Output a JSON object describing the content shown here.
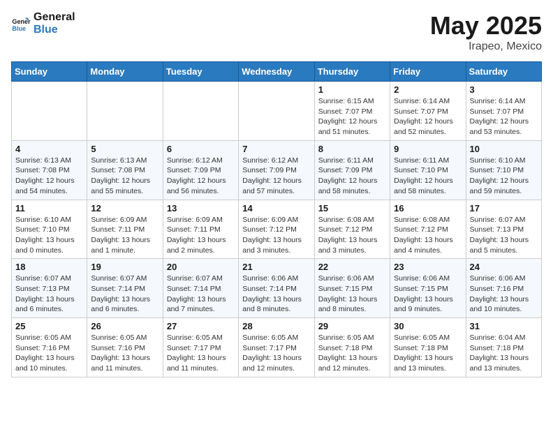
{
  "header": {
    "logo_line1": "General",
    "logo_line2": "Blue",
    "month": "May 2025",
    "location": "Irapeo, Mexico"
  },
  "weekdays": [
    "Sunday",
    "Monday",
    "Tuesday",
    "Wednesday",
    "Thursday",
    "Friday",
    "Saturday"
  ],
  "weeks": [
    [
      {
        "day": "",
        "info": ""
      },
      {
        "day": "",
        "info": ""
      },
      {
        "day": "",
        "info": ""
      },
      {
        "day": "",
        "info": ""
      },
      {
        "day": "1",
        "info": "Sunrise: 6:15 AM\nSunset: 7:07 PM\nDaylight: 12 hours\nand 51 minutes."
      },
      {
        "day": "2",
        "info": "Sunrise: 6:14 AM\nSunset: 7:07 PM\nDaylight: 12 hours\nand 52 minutes."
      },
      {
        "day": "3",
        "info": "Sunrise: 6:14 AM\nSunset: 7:07 PM\nDaylight: 12 hours\nand 53 minutes."
      }
    ],
    [
      {
        "day": "4",
        "info": "Sunrise: 6:13 AM\nSunset: 7:08 PM\nDaylight: 12 hours\nand 54 minutes."
      },
      {
        "day": "5",
        "info": "Sunrise: 6:13 AM\nSunset: 7:08 PM\nDaylight: 12 hours\nand 55 minutes."
      },
      {
        "day": "6",
        "info": "Sunrise: 6:12 AM\nSunset: 7:09 PM\nDaylight: 12 hours\nand 56 minutes."
      },
      {
        "day": "7",
        "info": "Sunrise: 6:12 AM\nSunset: 7:09 PM\nDaylight: 12 hours\nand 57 minutes."
      },
      {
        "day": "8",
        "info": "Sunrise: 6:11 AM\nSunset: 7:09 PM\nDaylight: 12 hours\nand 58 minutes."
      },
      {
        "day": "9",
        "info": "Sunrise: 6:11 AM\nSunset: 7:10 PM\nDaylight: 12 hours\nand 58 minutes."
      },
      {
        "day": "10",
        "info": "Sunrise: 6:10 AM\nSunset: 7:10 PM\nDaylight: 12 hours\nand 59 minutes."
      }
    ],
    [
      {
        "day": "11",
        "info": "Sunrise: 6:10 AM\nSunset: 7:10 PM\nDaylight: 13 hours\nand 0 minutes."
      },
      {
        "day": "12",
        "info": "Sunrise: 6:09 AM\nSunset: 7:11 PM\nDaylight: 13 hours\nand 1 minute."
      },
      {
        "day": "13",
        "info": "Sunrise: 6:09 AM\nSunset: 7:11 PM\nDaylight: 13 hours\nand 2 minutes."
      },
      {
        "day": "14",
        "info": "Sunrise: 6:09 AM\nSunset: 7:12 PM\nDaylight: 13 hours\nand 3 minutes."
      },
      {
        "day": "15",
        "info": "Sunrise: 6:08 AM\nSunset: 7:12 PM\nDaylight: 13 hours\nand 3 minutes."
      },
      {
        "day": "16",
        "info": "Sunrise: 6:08 AM\nSunset: 7:12 PM\nDaylight: 13 hours\nand 4 minutes."
      },
      {
        "day": "17",
        "info": "Sunrise: 6:07 AM\nSunset: 7:13 PM\nDaylight: 13 hours\nand 5 minutes."
      }
    ],
    [
      {
        "day": "18",
        "info": "Sunrise: 6:07 AM\nSunset: 7:13 PM\nDaylight: 13 hours\nand 6 minutes."
      },
      {
        "day": "19",
        "info": "Sunrise: 6:07 AM\nSunset: 7:14 PM\nDaylight: 13 hours\nand 6 minutes."
      },
      {
        "day": "20",
        "info": "Sunrise: 6:07 AM\nSunset: 7:14 PM\nDaylight: 13 hours\nand 7 minutes."
      },
      {
        "day": "21",
        "info": "Sunrise: 6:06 AM\nSunset: 7:14 PM\nDaylight: 13 hours\nand 8 minutes."
      },
      {
        "day": "22",
        "info": "Sunrise: 6:06 AM\nSunset: 7:15 PM\nDaylight: 13 hours\nand 8 minutes."
      },
      {
        "day": "23",
        "info": "Sunrise: 6:06 AM\nSunset: 7:15 PM\nDaylight: 13 hours\nand 9 minutes."
      },
      {
        "day": "24",
        "info": "Sunrise: 6:06 AM\nSunset: 7:16 PM\nDaylight: 13 hours\nand 10 minutes."
      }
    ],
    [
      {
        "day": "25",
        "info": "Sunrise: 6:05 AM\nSunset: 7:16 PM\nDaylight: 13 hours\nand 10 minutes."
      },
      {
        "day": "26",
        "info": "Sunrise: 6:05 AM\nSunset: 7:16 PM\nDaylight: 13 hours\nand 11 minutes."
      },
      {
        "day": "27",
        "info": "Sunrise: 6:05 AM\nSunset: 7:17 PM\nDaylight: 13 hours\nand 11 minutes."
      },
      {
        "day": "28",
        "info": "Sunrise: 6:05 AM\nSunset: 7:17 PM\nDaylight: 13 hours\nand 12 minutes."
      },
      {
        "day": "29",
        "info": "Sunrise: 6:05 AM\nSunset: 7:18 PM\nDaylight: 13 hours\nand 12 minutes."
      },
      {
        "day": "30",
        "info": "Sunrise: 6:05 AM\nSunset: 7:18 PM\nDaylight: 13 hours\nand 13 minutes."
      },
      {
        "day": "31",
        "info": "Sunrise: 6:04 AM\nSunset: 7:18 PM\nDaylight: 13 hours\nand 13 minutes."
      }
    ]
  ]
}
